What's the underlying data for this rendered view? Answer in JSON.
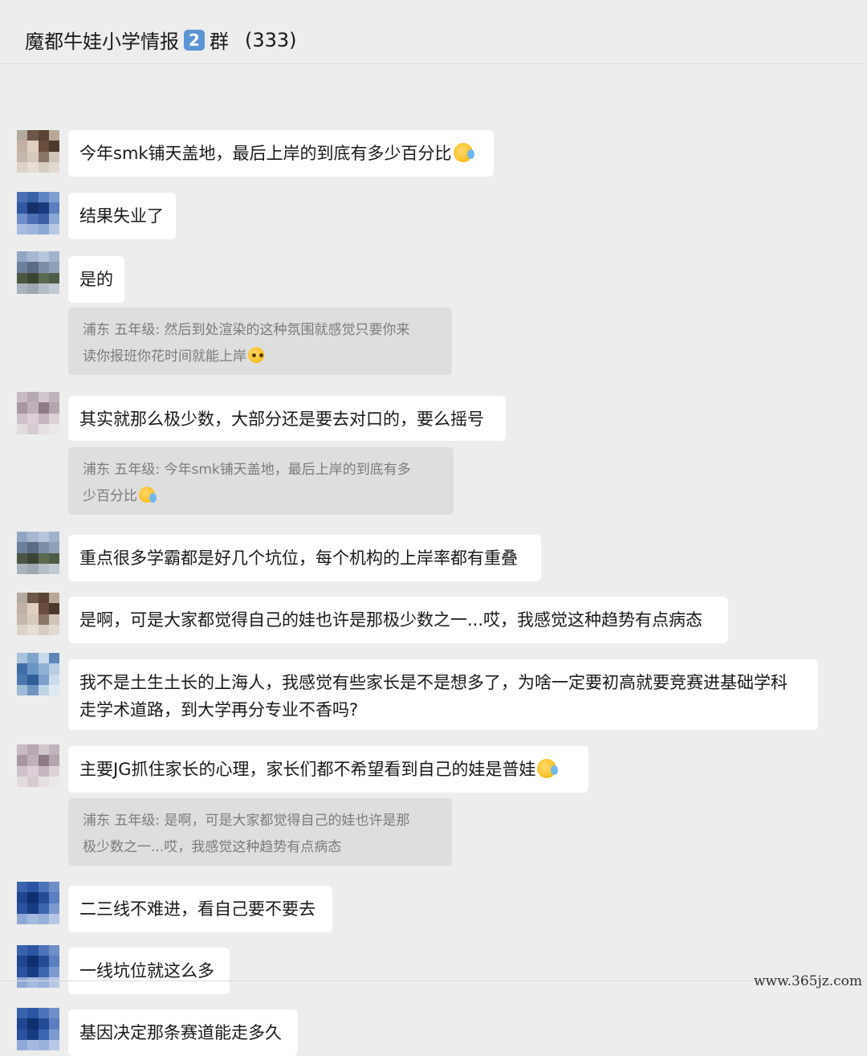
{
  "header": {
    "title_prefix": "魔都牛娃小学情报",
    "title_badge": "2",
    "title_suffix": "群",
    "member_count": "(333)"
  },
  "messages": [
    {
      "text": "今年smk铺天盖地，最后上岸的到底有多少百分比",
      "emoji": "crying-laughing-emoji",
      "avatar": [
        "#b3a99f",
        "#6e5649",
        "#594334",
        "#b9a896",
        "#c1b1a5",
        "#e0cfc1",
        "#6a4d3c",
        "#4d392c",
        "#c5b8ad",
        "#d6c9bd",
        "#8a7566",
        "#d0c4b8",
        "#dcd2c9",
        "#e6ddd5",
        "#d8cdc3",
        "#e2d9d1"
      ]
    },
    {
      "text": "结果失业了",
      "avatar": [
        "#4a6fb2",
        "#3b62a7",
        "#5f86c4",
        "#7d9fd0",
        "#3057a0",
        "#16306a",
        "#1a3a7e",
        "#5b7ec0",
        "#6d8ec8",
        "#4d6fb3",
        "#3b5da6",
        "#8aa7d6",
        "#a6bce0",
        "#9db5dc",
        "#8ea8d6",
        "#b8c9e6"
      ]
    },
    {
      "text": "是的",
      "quote": "浦东 五年级: 然后到处渲染的这种氛围就感觉只要你来\n读你报班你花时间就能上岸",
      "quote_emoji": "pleading-face-emoji",
      "avatar": [
        "#8fa6c4",
        "#a5b8d0",
        "#b7c7db",
        "#9fb3cd",
        "#6c7f9b",
        "#5b6c85",
        "#7b8ea8",
        "#8ea1ba",
        "#4b5643",
        "#3a4434",
        "#5d6a52",
        "#4e5b46",
        "#aab3bd",
        "#9ea8b3",
        "#b5bec7",
        "#c2cad2"
      ]
    },
    {
      "text": "其实就那么极少数，大部分还是要去对口的，要么摇号",
      "quote": "浦东 五年级: 今年smk铺天盖地，最后上岸的到底有多\n少百分比",
      "quote_emoji": "crying-laughing-emoji",
      "avatar": [
        "#c8bcc4",
        "#b7a9b3",
        "#d2c6cd",
        "#c0b3bb",
        "#a897a2",
        "#bfb0b9",
        "#8d7a86",
        "#b4a5ae",
        "#cfc2ca",
        "#d9cfd5",
        "#c4b7bf",
        "#dcd3d8",
        "#e2dbdf",
        "#d5cbd1",
        "#e6e0e3",
        "#ece7ea"
      ]
    },
    {
      "text": "重点很多学霸都是好几个坑位，每个机构的上岸率都有重叠",
      "avatar": [
        "#8fa6c4",
        "#a5b8d0",
        "#b7c7db",
        "#9fb3cd",
        "#6c7f9b",
        "#5b6c85",
        "#7b8ea8",
        "#8ea1ba",
        "#4b5643",
        "#3a4434",
        "#5d6a52",
        "#4e5b46",
        "#aab3bd",
        "#9ea8b3",
        "#b5bec7",
        "#c2cad2"
      ]
    },
    {
      "text": "是啊，可是大家都觉得自己的娃也许是那极少数之一...哎，我感觉这种趋势有点病态",
      "avatar": [
        "#b3a99f",
        "#6e5649",
        "#594334",
        "#b9a896",
        "#c1b1a5",
        "#e0cfc1",
        "#6a4d3c",
        "#4d392c",
        "#c5b8ad",
        "#d6c9bd",
        "#8a7566",
        "#d0c4b8",
        "#dcd2c9",
        "#e6ddd5",
        "#d8cdc3",
        "#e2d9d1"
      ]
    },
    {
      "text": "我不是土生土长的上海人，我感觉有些家长是不是想多了，为啥一定要初高就要竞赛进基础学科\n走学术道路，到大学再分专业不香吗?",
      "avatar": [
        "#a9c3de",
        "#7ea4cc",
        "#c6d8ea",
        "#5d87b8",
        "#3f6ea6",
        "#6b95c4",
        "#8fb0d3",
        "#b6cde4",
        "#4a78ad",
        "#2f5f97",
        "#7da0c9",
        "#cddcec",
        "#9fbad8",
        "#6f94c0",
        "#c0d4e8",
        "#dfe9f3"
      ]
    },
    {
      "text": "主要JG抓住家长的心理，家长们都不希望看到自己的娃是普娃",
      "emoji": "crying-laughing-emoji",
      "quote": "浦东 五年级: 是啊，可是大家都觉得自己的娃也许是那\n极少数之一...哎，我感觉这种趋势有点病态",
      "avatar": [
        "#c8bcc4",
        "#b7a9b3",
        "#d2c6cd",
        "#c0b3bb",
        "#a897a2",
        "#bfb0b9",
        "#8d7a86",
        "#b4a5ae",
        "#cfc2ca",
        "#d9cfd5",
        "#c4b7bf",
        "#dcd3d8",
        "#e2dbdf",
        "#d5cbd1",
        "#e6e0e3",
        "#ece7ea"
      ]
    },
    {
      "text": "二三线不难进，看自己要不要去",
      "avatar": [
        "#3a63ad",
        "#2c56a3",
        "#4d74b9",
        "#6e8fc8",
        "#1f4690",
        "#0f2f6e",
        "#244c96",
        "#5a7fc0",
        "#2a52a0",
        "#183c82",
        "#3d66b1",
        "#7d9bcf",
        "#8ea9d6",
        "#a3b9de",
        "#98b1da",
        "#b6c8e5"
      ]
    },
    {
      "text": "一线坑位就这么多",
      "avatar": [
        "#3a63ad",
        "#2c56a3",
        "#4d74b9",
        "#6e8fc8",
        "#1f4690",
        "#0f2f6e",
        "#244c96",
        "#5a7fc0",
        "#2a52a0",
        "#183c82",
        "#3d66b1",
        "#7d9bcf",
        "#8ea9d6",
        "#a3b9de",
        "#98b1da",
        "#b6c8e5"
      ]
    },
    {
      "text": "基因决定那条赛道能走多久",
      "avatar": [
        "#3a63ad",
        "#2c56a3",
        "#4d74b9",
        "#6e8fc8",
        "#1f4690",
        "#0f2f6e",
        "#244c96",
        "#5a7fc0",
        "#2a52a0",
        "#183c82",
        "#3d66b1",
        "#7d9bcf",
        "#8ea9d6",
        "#a3b9de",
        "#98b1da",
        "#b6c8e5"
      ]
    }
  ],
  "watermark": "www.365jz.com"
}
